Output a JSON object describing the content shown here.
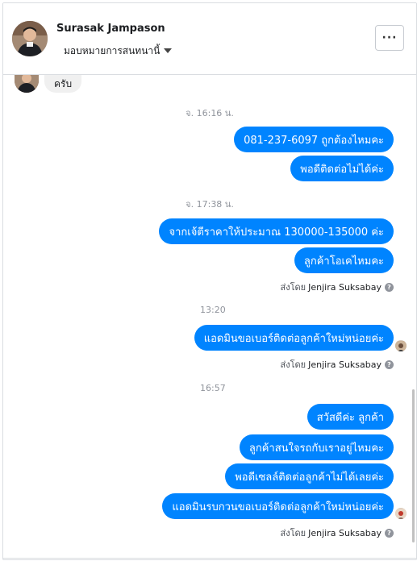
{
  "header": {
    "contact_name": "Surasak Jampason",
    "assign_label": "มอบหมายการสนทนานี้",
    "more_label": "···"
  },
  "thread": {
    "incoming_top": {
      "text": "ครับ"
    },
    "groups": [
      {
        "timestamp": "จ. 16:16 น.",
        "messages": [
          "081-237-6097 ถูกต้องไหมคะ",
          "พอดีติดต่อไม่ได้ค่ะ"
        ]
      },
      {
        "timestamp": "จ. 17:38 น.",
        "messages": [
          "จากเจ้ตีราคาให้ประมาณ 130000-135000 ค่ะ",
          "ลูกค้าโอเคไหมคะ"
        ],
        "sent_by_prefix": "ส่งโดย",
        "sent_by_name": "Jenjira Suksabay"
      },
      {
        "timestamp": "13:20",
        "messages": [
          "แอดมินขอเบอร์ติดต่อลูกค้าใหม่หน่อยค่ะ"
        ],
        "sent_by_prefix": "ส่งโดย",
        "sent_by_name": "Jenjira Suksabay"
      },
      {
        "timestamp": "16:57",
        "messages": [
          "สวัสดีค่ะ ลูกค้า",
          "ลูกค้าสนใจรถกับเราอยู่ไหมคะ",
          "พอดีเซลล์ติดต่อลูกค้าไม่ได้เลยค่ะ",
          "แอดมินรบกวนขอเบอร์ติดต่อลูกค้าใหม่หน่อยค่ะ"
        ],
        "sent_by_prefix": "ส่งโดย",
        "sent_by_name": "Jenjira Suksabay"
      }
    ],
    "help_glyph": "?"
  },
  "colors": {
    "outgoing_bubble": "#0084ff",
    "incoming_bubble": "#f0f0f0",
    "timestamp_text": "#90949c"
  }
}
